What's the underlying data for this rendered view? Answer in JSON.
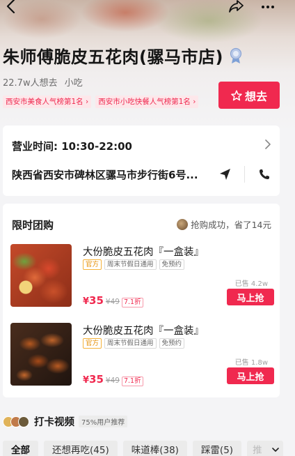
{
  "nav": {
    "back_icon": "chevron-left-icon",
    "share_icon": "share-arrow-icon",
    "more_icon": "more-dots-icon"
  },
  "shop": {
    "name": "朱师傅脆皮五花肉(骡马市店)",
    "want_count": "22.7w人想去",
    "category": "小吃",
    "rankings": [
      "西安市美食人气榜第1名 ›",
      "西安市小吃快餐人气榜第1名 ›"
    ],
    "want_button": "想去"
  },
  "info": {
    "hours": "营业时间: 10:30-22:00",
    "address": "陕西省西安市碑林区骡马市步行街6号..."
  },
  "deals": {
    "title": "限时团购",
    "grab_text": "抢购成功，省了14元",
    "items": [
      {
        "name": "大份脆皮五花肉『一盒装』",
        "tags": [
          "官方",
          "周末节假日通用",
          "免预约"
        ],
        "sold": "已售 4.2w",
        "price_symbol": "¥",
        "price": "35",
        "original": "¥49",
        "discount": "7.1折",
        "button": "马上抢"
      },
      {
        "name": "大份脆皮五花肉『一盒装』",
        "tags": [
          "官方",
          "周末节假日通用",
          "免预约"
        ],
        "sold": "已售 1.8w",
        "price_symbol": "¥",
        "price": "35",
        "original": "¥49",
        "discount": "7.1折",
        "button": "马上抢"
      }
    ]
  },
  "checkin": {
    "title": "打卡视频",
    "badge": "75%用户推荐"
  },
  "filters": [
    "全部",
    "还想再吃(45)",
    "味道棒(38)",
    "踩雷(5)",
    "推"
  ],
  "colors": {
    "accent": "#f0294f",
    "rank_bg": "#fde7ea",
    "official_tag": "#e58d00"
  }
}
